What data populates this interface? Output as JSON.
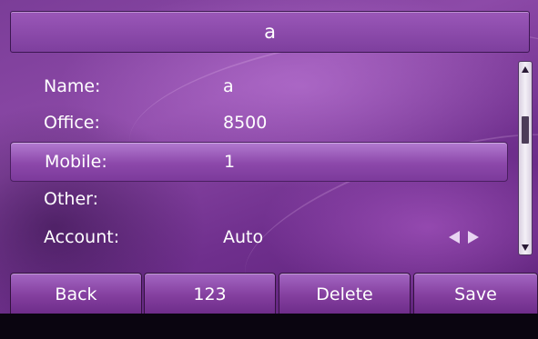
{
  "title": "a",
  "fields": [
    {
      "label": "Name:",
      "value": "a"
    },
    {
      "label": "Office:",
      "value": "8500"
    },
    {
      "label": "Mobile:",
      "value": "1"
    },
    {
      "label": "Other:",
      "value": ""
    },
    {
      "label": "Account:",
      "value": "Auto"
    }
  ],
  "selected_field": "Mobile:",
  "softkeys": {
    "back": "Back",
    "num": "123",
    "delete": "Delete",
    "save": "Save"
  },
  "icons": {
    "account_prev": "arrow-left-icon",
    "account_next": "arrow-right-icon",
    "scroll_up": "scroll-up-arrow-icon",
    "scroll_down": "scroll-down-arrow-icon"
  },
  "colors": {
    "background": "#7b3d98",
    "highlight": "#9a5ab9",
    "text": "#ffffff"
  }
}
